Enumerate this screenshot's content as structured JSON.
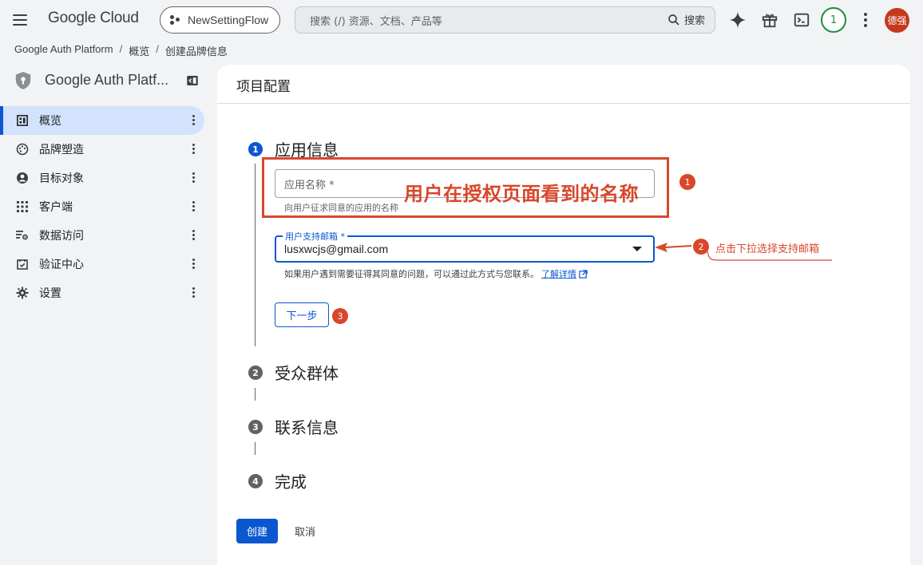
{
  "header": {
    "logo": "Google Cloud",
    "project": "NewSettingFlow",
    "search_placeholder": "搜索 (/) 资源、文档、产品等",
    "search_button": "搜索",
    "notification_count": "1",
    "avatar_text": "德强"
  },
  "breadcrumb": [
    "Google Auth Platform",
    "概览",
    "创建品牌信息"
  ],
  "sidebar": {
    "title": "Google Auth Platf...",
    "items": [
      {
        "label": "概览",
        "icon": "dashboard-icon",
        "active": true
      },
      {
        "label": "品牌塑造",
        "icon": "palette-icon",
        "active": false
      },
      {
        "label": "目标对象",
        "icon": "account-circle-icon",
        "active": false
      },
      {
        "label": "客户端",
        "icon": "apps-grid-icon",
        "active": false
      },
      {
        "label": "数据访问",
        "icon": "data-access-icon",
        "active": false
      },
      {
        "label": "验证中心",
        "icon": "verified-icon",
        "active": false
      },
      {
        "label": "设置",
        "icon": "gear-icon",
        "active": false
      }
    ]
  },
  "main": {
    "title": "项目配置",
    "steps": [
      {
        "num": "1",
        "label": "应用信息"
      },
      {
        "num": "2",
        "label": "受众群体"
      },
      {
        "num": "3",
        "label": "联系信息"
      },
      {
        "num": "4",
        "label": "完成"
      }
    ],
    "app_name_label": "应用名称 *",
    "app_name_hint": "向用户征求同意的应用的名称",
    "email_label": "用户支持邮箱 *",
    "email_value": "lusxwcjs@gmail.com",
    "email_hint": "如果用户遇到需要征得其同意的问题，可以通过此方式与您联系。",
    "learn_more": "了解详情",
    "next_button": "下一步",
    "create_button": "创建",
    "cancel_button": "取消"
  },
  "annotations": {
    "overlay_title": "用户在授权页面看到的名称",
    "marker1": "1",
    "marker2": "2",
    "marker3": "3",
    "note2": "点击下拉选择支持邮箱",
    "color": "#d9472b"
  },
  "colors": {
    "primary": "#0b57d0",
    "accent_red": "#d9472b",
    "avatar_bg": "#c5391d",
    "active_nav": "#d3e3fd"
  }
}
